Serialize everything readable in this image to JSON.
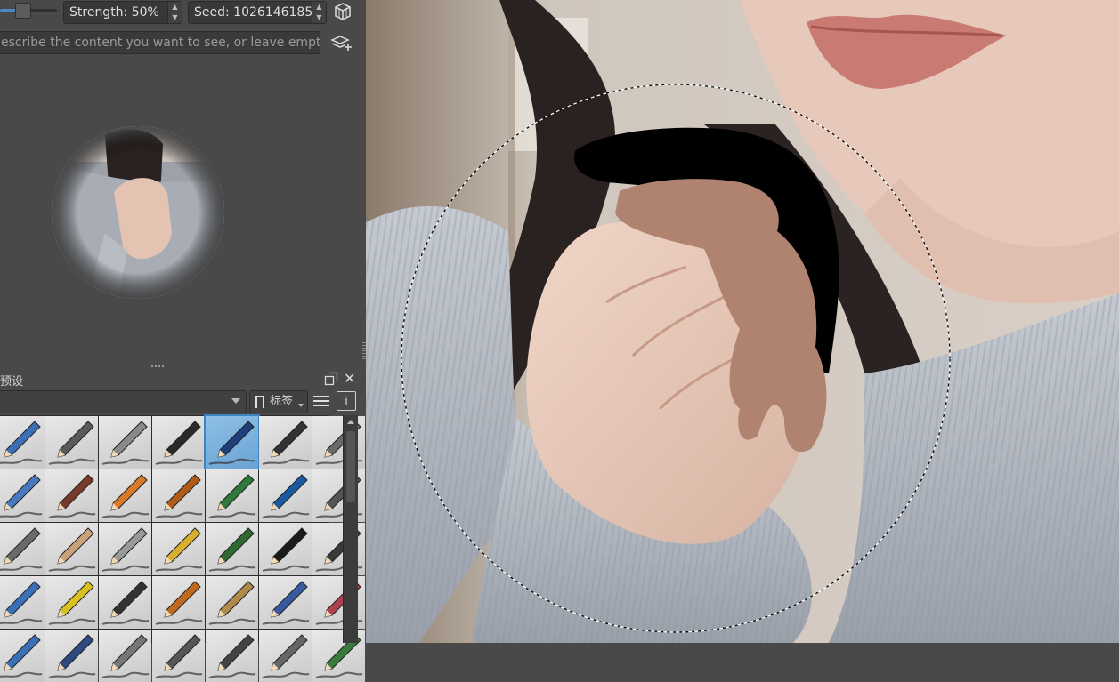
{
  "toolbar": {
    "strength_label": "Strength: 50%",
    "strength_value": 0.5,
    "seed_label": "Seed: 1026146185",
    "prompt_placeholder": "escribe the content you want to see, or leave empty."
  },
  "icons": {
    "cube": "cube-icon",
    "add_layers": "layers-add-icon",
    "float": "float-dock-icon",
    "close": "close-icon",
    "tag": "bookmark-icon",
    "menu": "hamburger-menu-icon",
    "info": "info-panel-icon"
  },
  "presets_docker": {
    "title": "预设",
    "tag_label": "标签",
    "close_glyph": "✕",
    "info_glyph": "i"
  },
  "colors": {
    "panel_bg": "#494949",
    "field_bg": "#383838",
    "selection_blue": "#6aa3d3",
    "skin_mask": "#b08270"
  }
}
